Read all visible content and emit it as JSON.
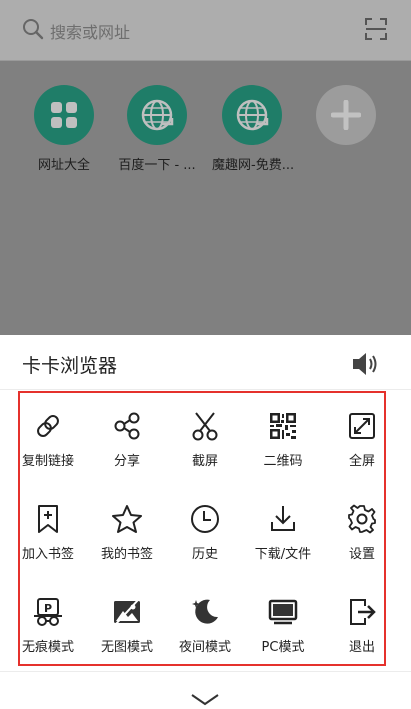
{
  "search": {
    "placeholder": "搜索或网址"
  },
  "shortcuts": [
    {
      "label": "网址大全",
      "icon": "grid-icon"
    },
    {
      "label": "百度一下 - ...",
      "icon": "globe-icon"
    },
    {
      "label": "魔趣网-免费...",
      "icon": "globe-icon"
    },
    {
      "label": "",
      "icon": "add-icon"
    }
  ],
  "sheet": {
    "title": "卡卡浏览器",
    "items": [
      {
        "label": "复制链接",
        "icon": "link-icon"
      },
      {
        "label": "分享",
        "icon": "share-icon"
      },
      {
        "label": "截屏",
        "icon": "scissors-icon"
      },
      {
        "label": "二维码",
        "icon": "qr-code-icon"
      },
      {
        "label": "全屏",
        "icon": "fullscreen-icon"
      },
      {
        "label": "加入书签",
        "icon": "bookmark-add-icon"
      },
      {
        "label": "我的书签",
        "icon": "star-icon"
      },
      {
        "label": "历史",
        "icon": "clock-icon"
      },
      {
        "label": "下载/文件",
        "icon": "download-icon"
      },
      {
        "label": "设置",
        "icon": "gear-icon"
      },
      {
        "label": "无痕模式",
        "icon": "incognito-icon"
      },
      {
        "label": "无图模式",
        "icon": "no-image-icon"
      },
      {
        "label": "夜间模式",
        "icon": "moon-icon"
      },
      {
        "label": "PC模式",
        "icon": "monitor-icon"
      },
      {
        "label": "退出",
        "icon": "exit-icon"
      }
    ]
  },
  "colors": {
    "accent_teal": "#1f8a72",
    "highlight_red": "#e5312c"
  }
}
